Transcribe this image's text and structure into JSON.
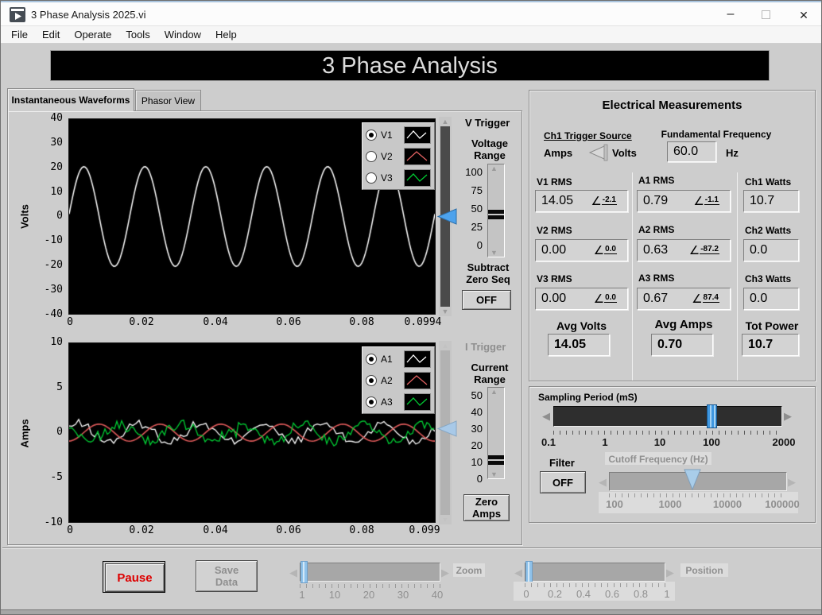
{
  "window": {
    "title": "3 Phase Analysis 2025.vi",
    "menu": [
      "File",
      "Edit",
      "Operate",
      "Tools",
      "Window",
      "Help"
    ],
    "icons": {
      "minimize": "–",
      "close": "✕"
    }
  },
  "banner": {
    "title": "3 Phase Analysis"
  },
  "tabs": {
    "tab1": "Instantaneous Waveforms",
    "tab2": "Phasor View"
  },
  "volt_graph": {
    "ylabel": "Volts",
    "yticks": [
      "40",
      "30",
      "20",
      "10",
      "0",
      "-10",
      "-20",
      "-30",
      "-40"
    ],
    "xticks": [
      "0",
      "0.02",
      "0.04",
      "0.06",
      "0.08",
      "0.0994"
    ],
    "ymax": 40,
    "legend": [
      {
        "label": "V1",
        "selected": true,
        "color": "#ffffff"
      },
      {
        "label": "V2",
        "selected": false,
        "color": "#e06060"
      },
      {
        "label": "V3",
        "selected": false,
        "color": "#00cc33"
      }
    ],
    "series": [
      {
        "color": "#ffffff",
        "amp": 20.5,
        "cycles": 6,
        "phase": 0.05,
        "noise": 0,
        "lw": 1.5,
        "seed": 1,
        "step": 2
      }
    ]
  },
  "v_trigger": {
    "title": "V Trigger",
    "range_title": "Voltage Range",
    "scale": [
      "100",
      "75",
      "50",
      "25",
      "0"
    ],
    "subtract_label": "Subtract Zero Seq",
    "subtract_button": "OFF"
  },
  "amp_graph": {
    "ylabel": "Amps",
    "yticks": [
      "10",
      "5",
      "0",
      "-5",
      "-10"
    ],
    "xticks": [
      "0",
      "0.02",
      "0.04",
      "0.06",
      "0.08",
      "0.099"
    ],
    "ymax": 10,
    "legend": [
      {
        "label": "A1",
        "selected": true,
        "color": "#ffffff"
      },
      {
        "label": "A2",
        "selected": true,
        "color": "#e06060"
      },
      {
        "label": "A3",
        "selected": true,
        "color": "#00cc33"
      }
    ],
    "series": [
      {
        "color": "#ffffff",
        "amp": 1.0,
        "cycles": 6,
        "phase": 0.6,
        "noise": 0.5,
        "lw": 1.3,
        "seed": 13,
        "step": 4
      },
      {
        "color": "#e05a5a",
        "amp": 0.95,
        "cycles": 6,
        "phase": -1.5,
        "noise": 0,
        "lw": 1.6,
        "seed": 2,
        "step": 2
      },
      {
        "color": "#00cc33",
        "amp": 0.95,
        "cycles": 6,
        "phase": 2.7,
        "noise": 0.55,
        "lw": 1.3,
        "seed": 77,
        "step": 3,
        "spike": 1.2
      }
    ]
  },
  "i_trigger": {
    "title": "I Trigger",
    "range_title": "Current Range",
    "scale": [
      "50",
      "40",
      "30",
      "20",
      "10",
      "0"
    ],
    "zero_button": "Zero Amps"
  },
  "measurements": {
    "title": "Electrical Measurements",
    "angle_symbol": "∠",
    "trigger_source": {
      "label": "Ch1 Trigger Source",
      "left": "Amps",
      "right": "Volts"
    },
    "fundamental": {
      "label": "Fundamental Frequency",
      "value": "60.0",
      "unit": "Hz"
    },
    "readouts": {
      "v1": {
        "label": "V1 RMS",
        "value": "14.05",
        "angle": "-2.1"
      },
      "v2": {
        "label": "V2 RMS",
        "value": "0.00",
        "angle": "0.0"
      },
      "v3": {
        "label": "V3 RMS",
        "value": "0.00",
        "angle": "0.0"
      },
      "a1": {
        "label": "A1 RMS",
        "value": "0.79",
        "angle": "-1.1"
      },
      "a2": {
        "label": "A2 RMS",
        "value": "0.63",
        "angle": "-87.2"
      },
      "a3": {
        "label": "A3 RMS",
        "value": "0.67",
        "angle": "87.4"
      },
      "ch1": {
        "label": "Ch1 Watts",
        "value": "10.7"
      },
      "ch2": {
        "label": "Ch2 Watts",
        "value": "0.0"
      },
      "ch3": {
        "label": "Ch3 Watts",
        "value": "0.0"
      }
    },
    "averages": {
      "volts": {
        "label": "Avg Volts",
        "value": "14.05"
      },
      "amps": {
        "label": "Avg Amps",
        "value": "0.70"
      },
      "power": {
        "label": "Tot Power",
        "value": "10.7"
      }
    }
  },
  "sampling": {
    "label": "Sampling Period (mS)",
    "ticks": [
      "0.1",
      "1",
      "10",
      "100",
      "2000"
    ]
  },
  "filter": {
    "label": "Filter",
    "button": "OFF",
    "cutoff_label": "Cutoff Frequency (Hz)",
    "cutoff_ticks": [
      "100",
      "1000",
      "10000",
      "100000"
    ]
  },
  "footer": {
    "pause": "Pause",
    "save": "Save Data",
    "zoom_label": "Zoom",
    "zoom_ticks": [
      "1",
      "10",
      "20",
      "30",
      "40"
    ],
    "position_label": "Position",
    "position_ticks": [
      "0",
      "0.2",
      "0.4",
      "0.6",
      "0.8",
      "1"
    ]
  },
  "chart_data": [
    {
      "type": "line",
      "title": "Instantaneous voltage waveforms",
      "ylabel": "Volts",
      "xlim": [
        0,
        0.0994
      ],
      "ylim": [
        -40,
        40
      ],
      "series": [
        {
          "name": "V1",
          "description": "60 Hz sine, ~20.5 V peak, RMS 14.05"
        },
        {
          "name": "V2",
          "description": "0 V (flat, RMS 0.00)"
        },
        {
          "name": "V3",
          "description": "0 V (flat, RMS 0.00)"
        }
      ]
    },
    {
      "type": "line",
      "title": "Instantaneous current waveforms",
      "ylabel": "Amps",
      "xlim": [
        0,
        0.099
      ],
      "ylim": [
        -10,
        10
      ],
      "series": [
        {
          "name": "A1",
          "description": "noisy 60 Hz, ~1 A peak, RMS 0.79"
        },
        {
          "name": "A2",
          "description": "smooth 60 Hz sine, ~0.95 A peak, RMS 0.63"
        },
        {
          "name": "A3",
          "description": "noisy 60 Hz, ~1 A peak, RMS 0.67"
        }
      ]
    }
  ]
}
